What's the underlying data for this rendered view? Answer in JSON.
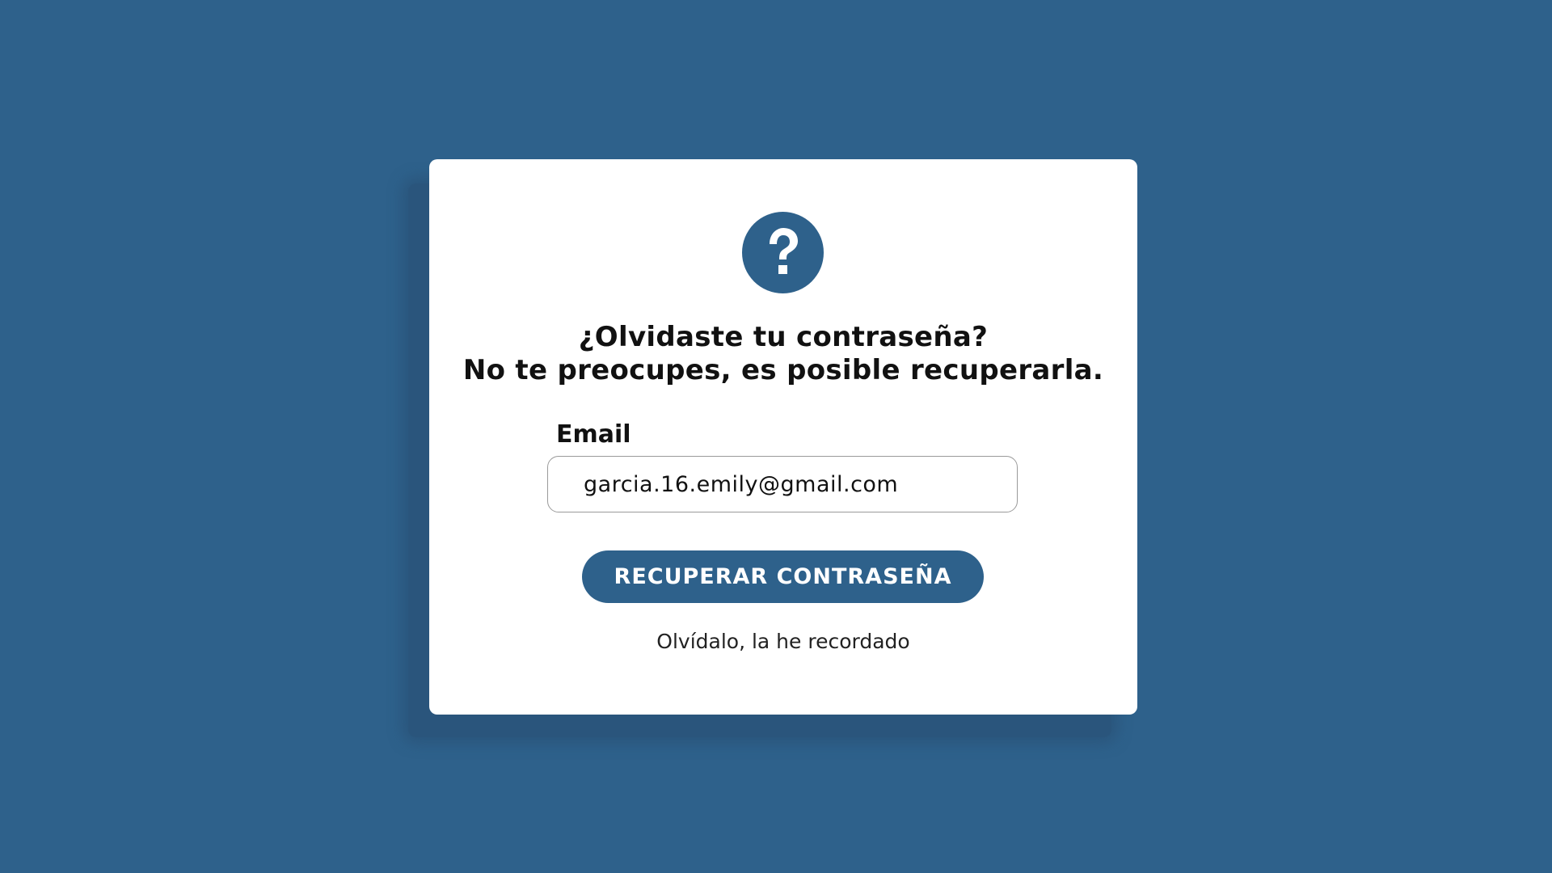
{
  "colors": {
    "background": "#2e618b",
    "card": "#ffffff",
    "accent": "#2e618b"
  },
  "icon": "question-mark-circle-icon",
  "heading": {
    "line1": "¿Olvidaste tu contraseña?",
    "line2": "No te preocupes, es posible recuperarla."
  },
  "form": {
    "email_label": "Email",
    "email_value": "garcia.16.emily@gmail.com"
  },
  "actions": {
    "recover_label": "RECUPERAR CONTRASEÑA",
    "remembered_link": "Olvídalo, la he recordado"
  }
}
